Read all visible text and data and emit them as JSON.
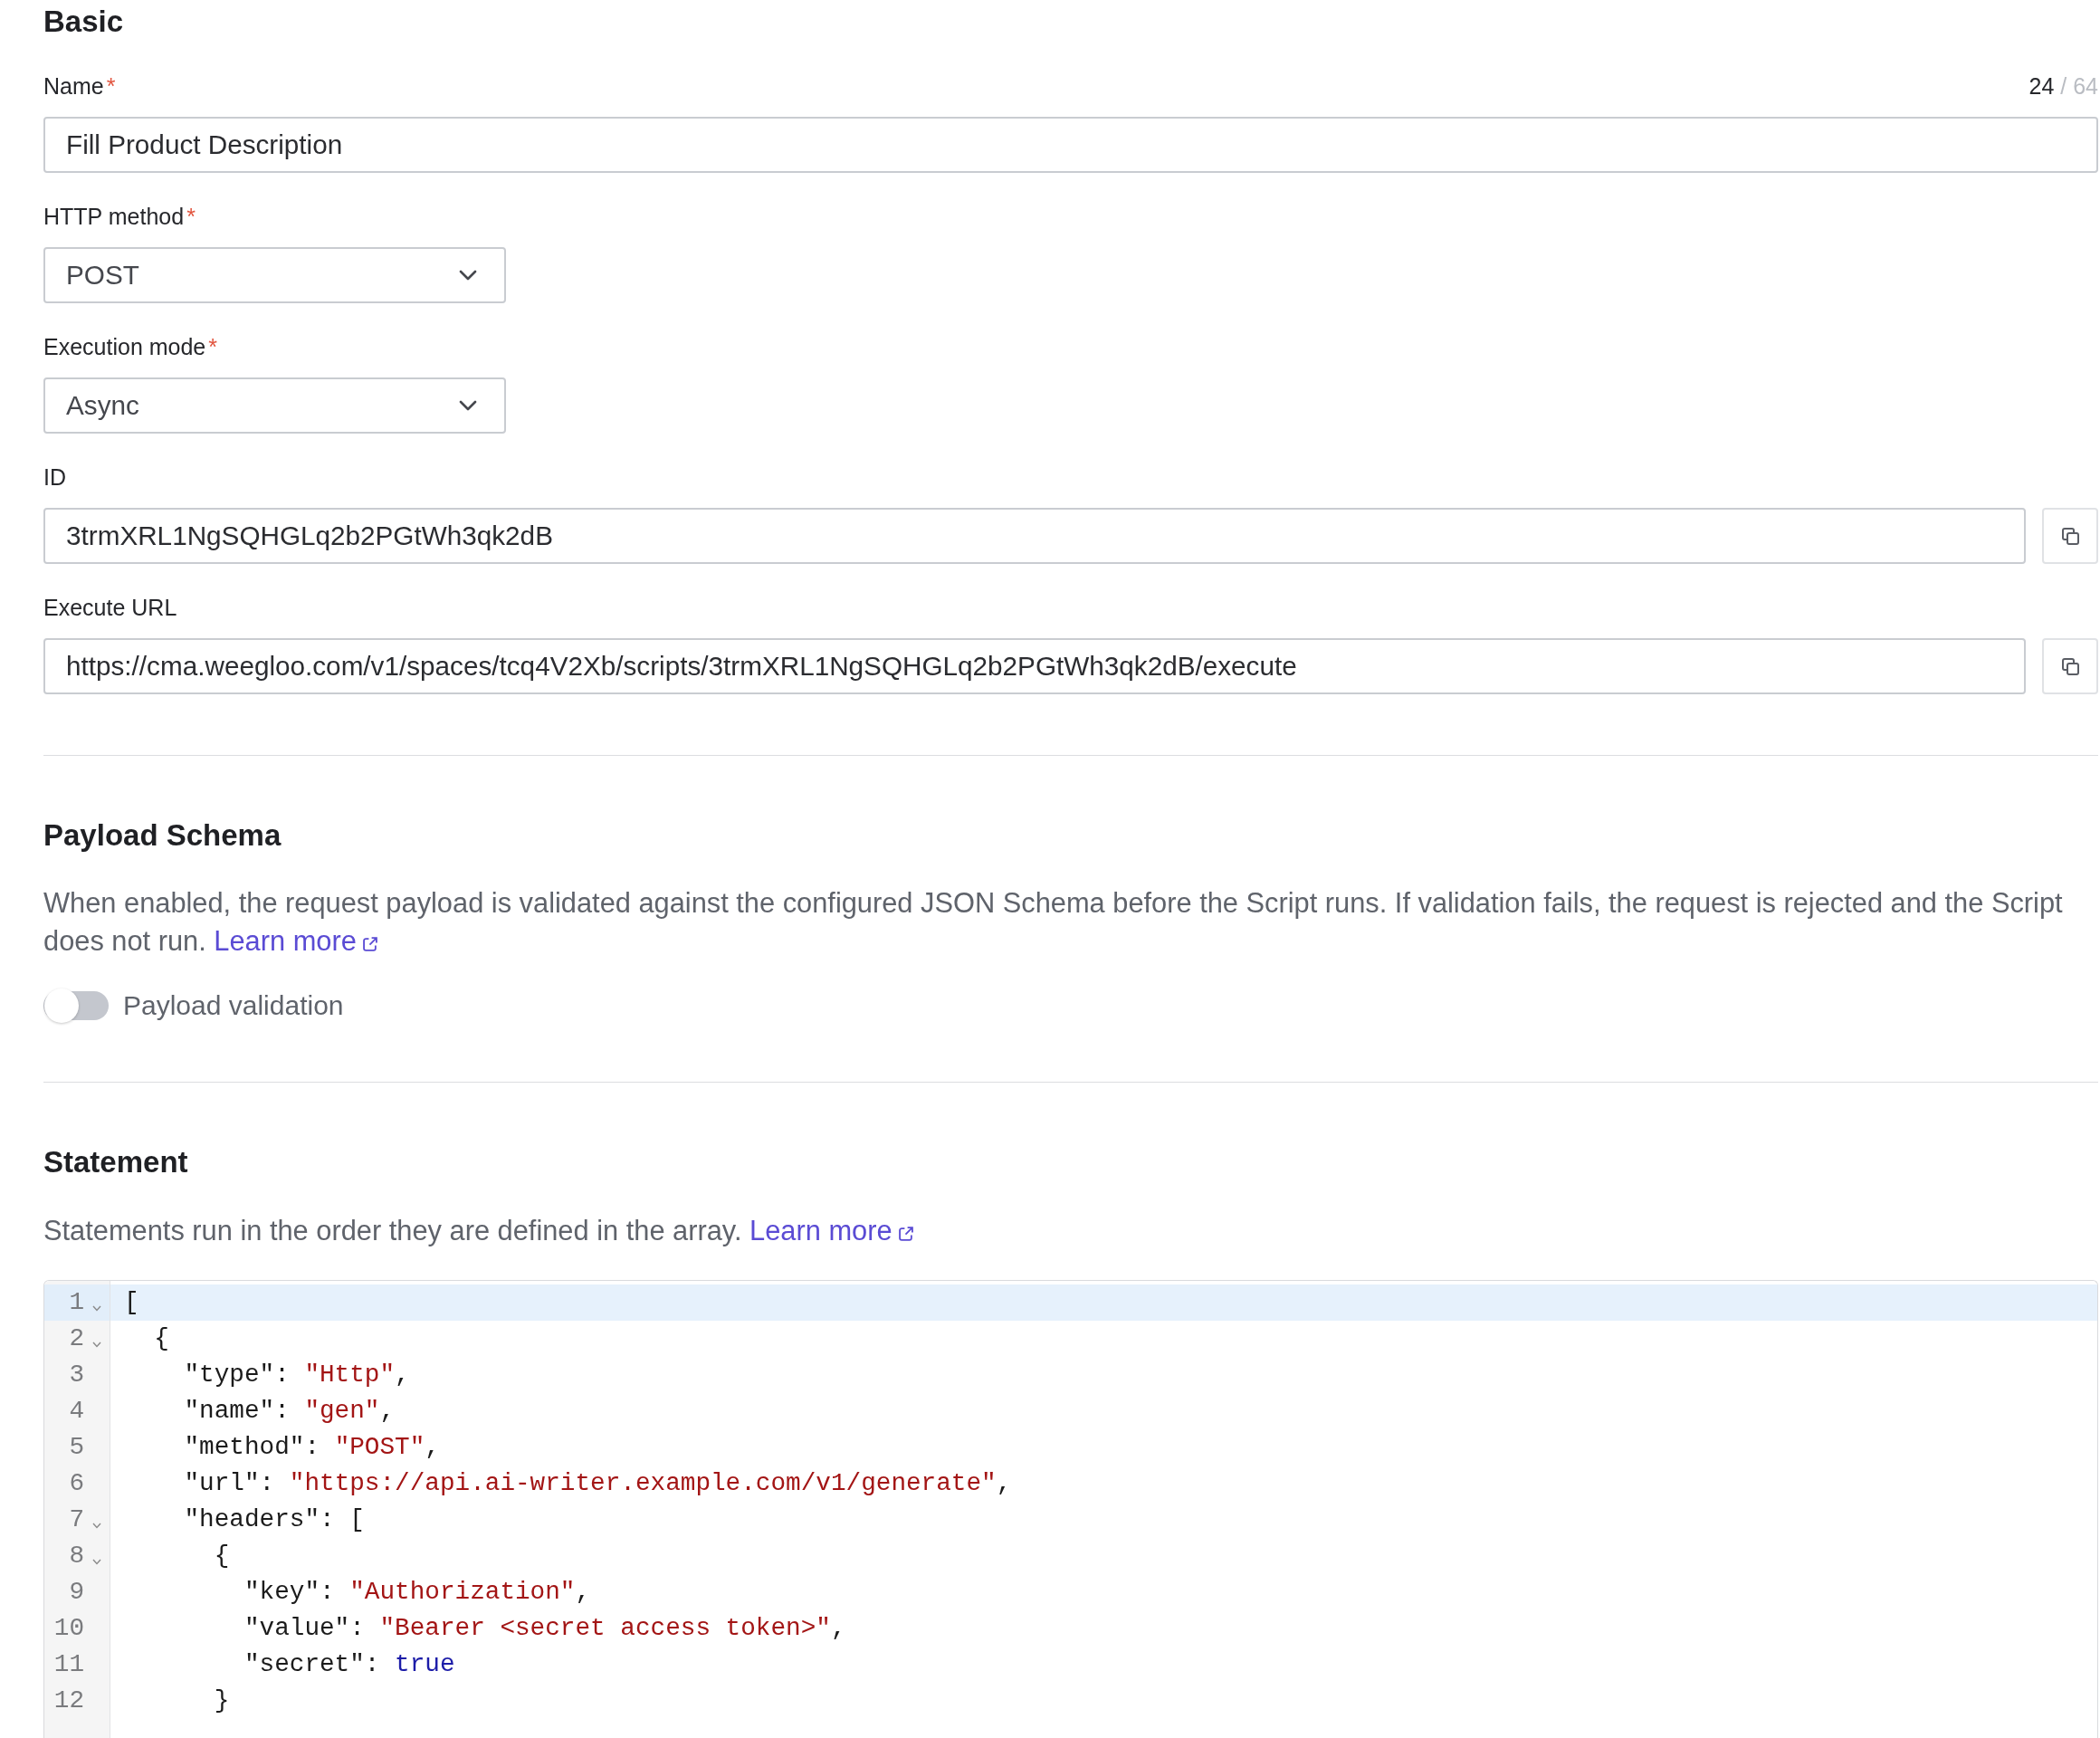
{
  "basic": {
    "title": "Basic",
    "fields": [
      {
        "kind": "text",
        "label": "Name",
        "required_mark": "*",
        "value": "Fill Product Description",
        "counter": {
          "count": "24",
          "limit": "/ 64"
        }
      },
      {
        "kind": "select",
        "label": "HTTP method",
        "required_mark": "*",
        "value": "POST"
      },
      {
        "kind": "select",
        "label": "Execution mode",
        "required_mark": "*",
        "value": "Async"
      },
      {
        "kind": "copy",
        "label": "ID",
        "value": "3trmXRL1NgSQHGLq2b2PGtWh3qk2dB"
      },
      {
        "kind": "copy",
        "label": "Execute URL",
        "value": "https://cma.weegloo.com/v1/spaces/tcq4V2Xb/scripts/3trmXRL1NgSQHGLq2b2PGtWh3qk2dB/execute"
      }
    ]
  },
  "payload_schema": {
    "title": "Payload Schema",
    "description": "When enabled, the request payload is validated against the configured JSON Schema before the Script runs. If validation fails, the request is rejected and the Script does not run.",
    "link": "Learn more",
    "toggle": {
      "label": "Payload validation",
      "on": false
    }
  },
  "statement": {
    "title": "Statement",
    "description": "Statements run in the order they are defined in the array.",
    "link": "Learn more",
    "editor": {
      "lines": [
        {
          "number": "1",
          "foldable": true,
          "active": true,
          "tokens": [
            {
              "kind": "plain",
              "text": "["
            }
          ]
        },
        {
          "number": "2",
          "foldable": true,
          "active": false,
          "tokens": [
            {
              "kind": "plain",
              "text": "  {"
            }
          ]
        },
        {
          "number": "3",
          "foldable": false,
          "active": false,
          "tokens": [
            {
              "kind": "plain",
              "text": "    \"type\": "
            },
            {
              "kind": "string",
              "text": "\"Http\""
            },
            {
              "kind": "plain",
              "text": ","
            }
          ]
        },
        {
          "number": "4",
          "foldable": false,
          "active": false,
          "tokens": [
            {
              "kind": "plain",
              "text": "    \"name\": "
            },
            {
              "kind": "string",
              "text": "\"gen\""
            },
            {
              "kind": "plain",
              "text": ","
            }
          ]
        },
        {
          "number": "5",
          "foldable": false,
          "active": false,
          "tokens": [
            {
              "kind": "plain",
              "text": "    \"method\": "
            },
            {
              "kind": "string",
              "text": "\"POST\""
            },
            {
              "kind": "plain",
              "text": ","
            }
          ]
        },
        {
          "number": "6",
          "foldable": false,
          "active": false,
          "tokens": [
            {
              "kind": "plain",
              "text": "    \"url\": "
            },
            {
              "kind": "string",
              "text": "\"https://api.ai-writer.example.com/v1/generate\""
            },
            {
              "kind": "plain",
              "text": ","
            }
          ]
        },
        {
          "number": "7",
          "foldable": true,
          "active": false,
          "tokens": [
            {
              "kind": "plain",
              "text": "    \"headers\": ["
            }
          ]
        },
        {
          "number": "8",
          "foldable": true,
          "active": false,
          "tokens": [
            {
              "kind": "plain",
              "text": "      {"
            }
          ]
        },
        {
          "number": "9",
          "foldable": false,
          "active": false,
          "tokens": [
            {
              "kind": "plain",
              "text": "        \"key\": "
            },
            {
              "kind": "string",
              "text": "\"Authorization\""
            },
            {
              "kind": "plain",
              "text": ","
            }
          ]
        },
        {
          "number": "10",
          "foldable": false,
          "active": false,
          "tokens": [
            {
              "kind": "plain",
              "text": "        \"value\": "
            },
            {
              "kind": "string",
              "text": "\"Bearer <secret access token>\""
            },
            {
              "kind": "plain",
              "text": ","
            }
          ]
        },
        {
          "number": "11",
          "foldable": false,
          "active": false,
          "tokens": [
            {
              "kind": "plain",
              "text": "        \"secret\": "
            },
            {
              "kind": "keyword",
              "text": "true"
            }
          ]
        },
        {
          "number": "12",
          "foldable": false,
          "active": false,
          "tokens": [
            {
              "kind": "plain",
              "text": "      }"
            }
          ]
        }
      ]
    }
  }
}
